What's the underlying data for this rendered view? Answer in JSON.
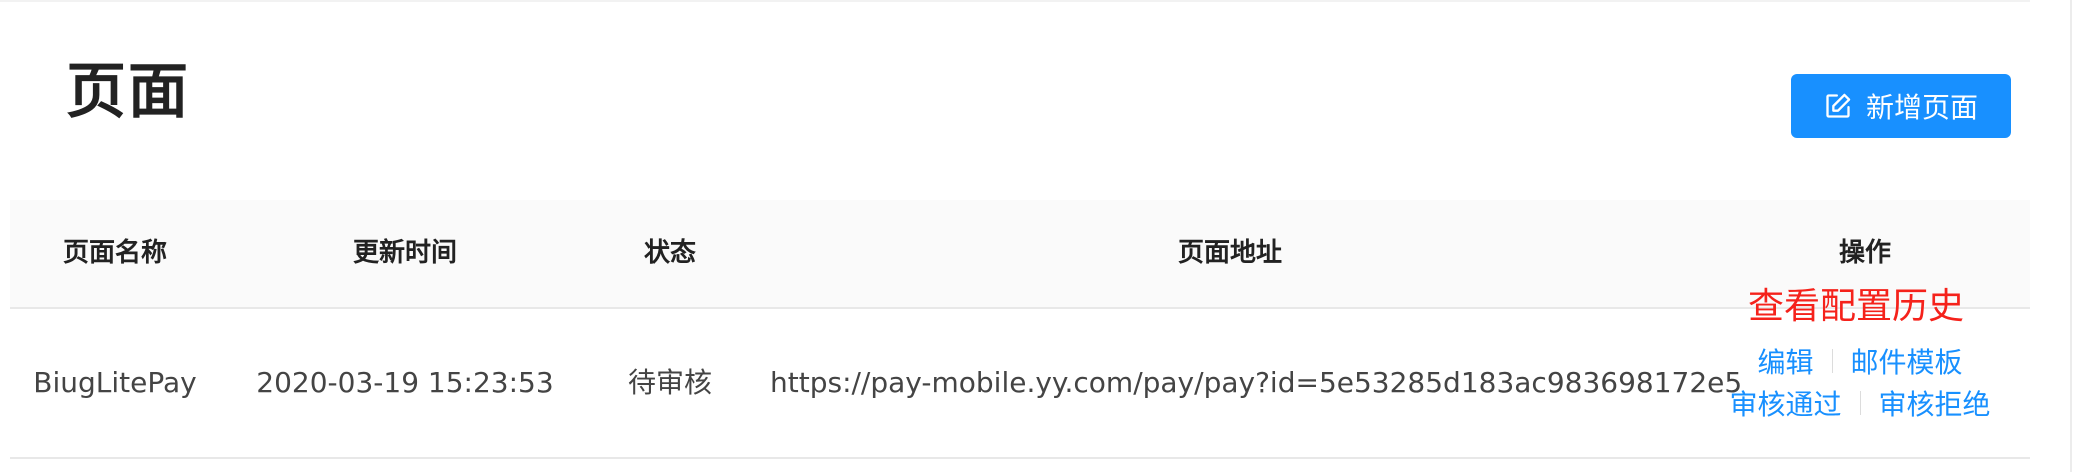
{
  "page": {
    "title": "页面"
  },
  "toolbar": {
    "new_page_label": "新增页面",
    "new_page_icon": "edit-square-icon",
    "accent_color": "#1890ff"
  },
  "table": {
    "columns": [
      "页面名称",
      "更新时间",
      "状态",
      "页面地址",
      "操作"
    ],
    "rows": [
      {
        "name": "BiugLitePay",
        "updated_at": "2020-03-19 15:23:53",
        "status": "待审核",
        "url": "https://pay-mobile.yy.com/pay/pay?id=5e53285d183ac983698172e5",
        "actions": {
          "edit": "编辑",
          "mail_template": "邮件模板",
          "approve": "审核通过",
          "reject": "审核拒绝"
        }
      }
    ]
  },
  "annotation": {
    "text": "查看配置历史",
    "color": "#f5221b"
  }
}
